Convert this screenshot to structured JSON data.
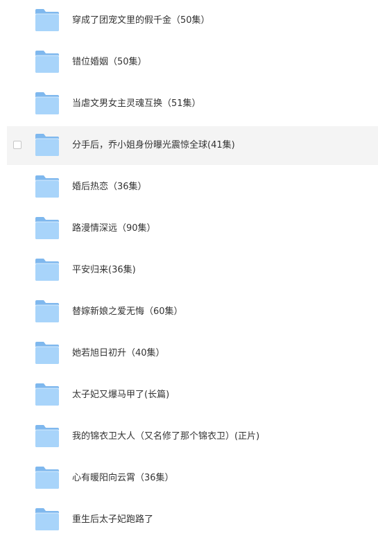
{
  "files": [
    {
      "name": "穿成了团宠文里的假千金（50集）",
      "icon": "folder-icon"
    },
    {
      "name": "错位婚姻（50集）",
      "icon": "folder-icon"
    },
    {
      "name": "当虐文男女主灵魂互换（51集）",
      "icon": "folder-icon"
    },
    {
      "name": "分手后，乔小姐身份曝光震惊全球(41集)",
      "icon": "folder-icon",
      "hovered": true
    },
    {
      "name": "婚后热恋（36集）",
      "icon": "folder-icon"
    },
    {
      "name": "路漫情深远（90集）",
      "icon": "folder-icon"
    },
    {
      "name": "平安归来(36集)",
      "icon": "folder-icon"
    },
    {
      "name": "替嫁新娘之爱无悔（60集）",
      "icon": "folder-icon"
    },
    {
      "name": "她若旭日初升（40集）",
      "icon": "folder-icon"
    },
    {
      "name": "太子妃又爆马甲了(长篇)",
      "icon": "folder-icon"
    },
    {
      "name": "我的锦衣卫大人（又名修了那个锦衣卫）(正片)",
      "icon": "folder-icon"
    },
    {
      "name": "心有暖阳向云霄（36集）",
      "icon": "folder-icon"
    },
    {
      "name": "重生后太子妃跑路了",
      "icon": "folder-icon"
    }
  ],
  "colors": {
    "folder_back": "#7fb8ee",
    "folder_front": "#a8d4fa",
    "hover_bg": "#f4f4f4",
    "text": "#333333"
  }
}
